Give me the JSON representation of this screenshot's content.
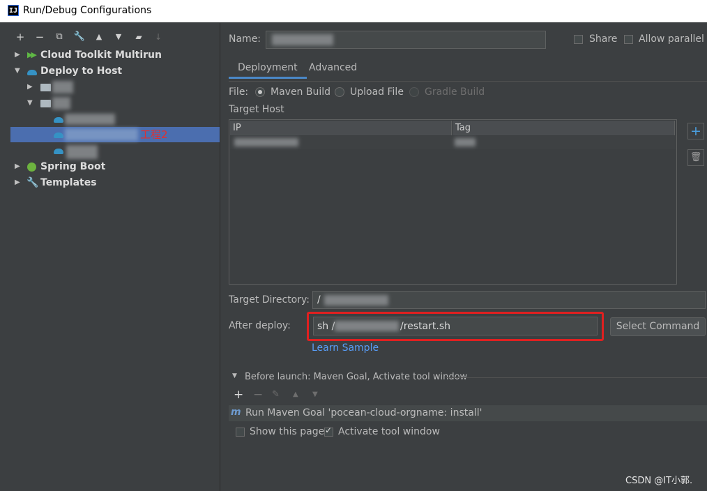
{
  "window": {
    "title": "Run/Debug Configurations",
    "app_icon": "IJ"
  },
  "left_toolbar": {
    "icons": [
      "add-icon",
      "remove-icon",
      "copy-icon",
      "wrench-icon",
      "move-up-icon",
      "move-down-icon",
      "new-folder-icon",
      "sort-icon"
    ],
    "glyphs": [
      "+",
      "−",
      "⧉",
      "🔧",
      "▲",
      "▼",
      "▰",
      "↓"
    ]
  },
  "tree": {
    "cloud_toolkit": "Cloud Toolkit Multirun",
    "deploy_to_host": "Deploy to Host",
    "selected_label": "工程2",
    "spring_boot": "Spring Boot",
    "templates": "Templates"
  },
  "form": {
    "name_label": "Name:",
    "name_label_mnemonic": "N",
    "share_label": "Share",
    "allow_parallel_label": "Allow parallel r",
    "tabs": [
      "Deployment",
      "Advanced"
    ],
    "file_label": "File:",
    "file_options": [
      "Maven Build",
      "Upload File",
      "Gradle Build"
    ],
    "file_selected": "Maven Build",
    "target_host_label": "Target Host",
    "table_columns": [
      "IP",
      "Tag"
    ],
    "target_directory_label": "Target Directory:",
    "target_directory_value": "/",
    "after_deploy_label": "After deploy:",
    "after_deploy_prefix": "sh /",
    "after_deploy_suffix": "/restart.sh",
    "select_command_label": "Select Command",
    "learn_sample_label": "Learn Sample",
    "before_launch_label": "Before launch: Maven Goal, Activate tool window",
    "before_launch_mnemonic": "B",
    "before_launch_item": "Run Maven Goal 'pocean-cloud-orgname: install'",
    "show_this_page_label": "Show this page",
    "show_this_page_checked": false,
    "activate_tool_window_label": "Activate tool window",
    "activate_tool_window_checked": true
  },
  "watermark": "CSDN @IT小郭.",
  "colors": {
    "selection": "#4b6eaf",
    "highlight_box": "#e02020",
    "link": "#589df6",
    "background": "#3c3f41"
  }
}
